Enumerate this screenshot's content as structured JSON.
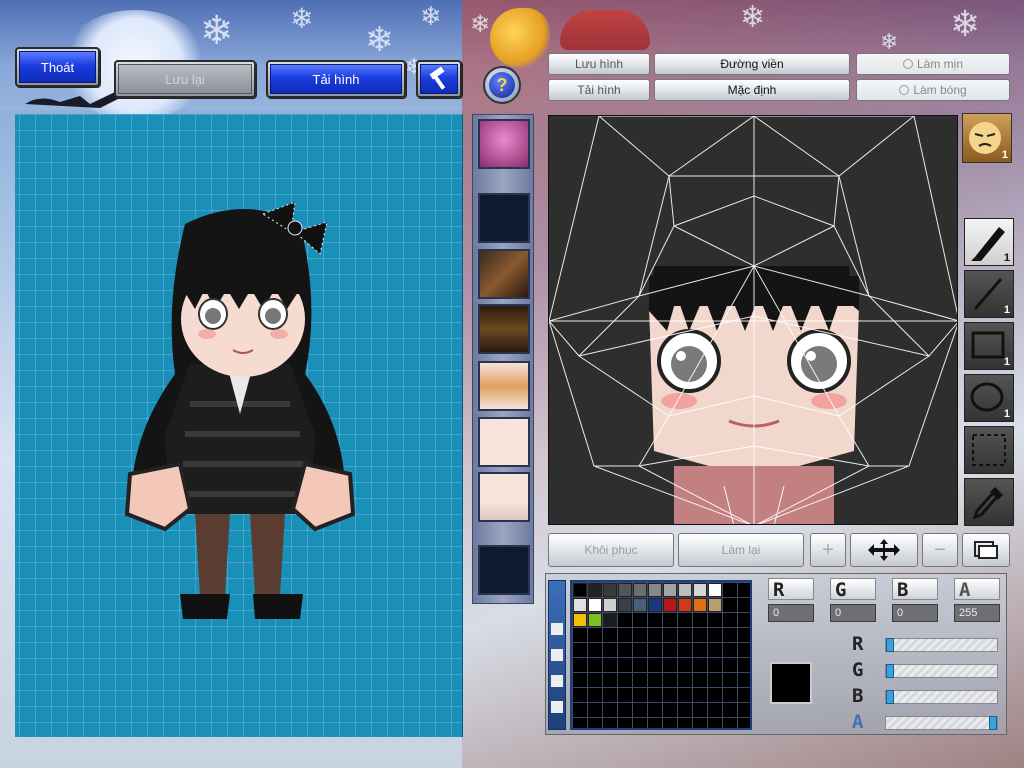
{
  "top_buttons": {
    "exit": "Thoát",
    "save": "Lưu lại",
    "reload": "Tải hình"
  },
  "help_icon_label": "?",
  "texture_panel": {
    "save_image": "Lưu hình",
    "outline": "Đường viền",
    "smooth": "Làm mịn",
    "load_image": "Tải hình",
    "default": "Mặc định",
    "shiny": "Làm bóng"
  },
  "tools": {
    "face_count": "1",
    "pen_count": "1",
    "line_count": "1",
    "rect_count": "1",
    "ellipse_count": "1"
  },
  "bottom_buttons": {
    "restore": "Khôi phục",
    "redo": "Làm lại",
    "zoom_in": "+",
    "zoom_out": "−"
  },
  "color": {
    "labels": {
      "r": "R",
      "g": "G",
      "b": "B",
      "a": "A"
    },
    "values": {
      "r": "0",
      "g": "0",
      "b": "0",
      "a": "255"
    },
    "current": "#000000",
    "slider_levels": {
      "r": 0.0,
      "g": 0.0,
      "b": 0.0,
      "a": 1.0
    }
  },
  "palette": {
    "row1": [
      "#000000",
      "#222222",
      "#3a3a3a",
      "#555555",
      "#6e6e6e",
      "#888888",
      "#a4a4a4",
      "#bdbdbd",
      "#d6d6d6",
      "#ffffff"
    ],
    "row2": [
      "#e0e0e0",
      "#ffffff",
      "#cfcfcf",
      "#3b3f4a",
      "#4a5f7a",
      "#1a3a80",
      "#b81818",
      "#d23a18",
      "#e07010",
      "#b8a070"
    ],
    "row3": [
      "#f0c000",
      "#7ac020",
      "#1c1c1c"
    ]
  }
}
